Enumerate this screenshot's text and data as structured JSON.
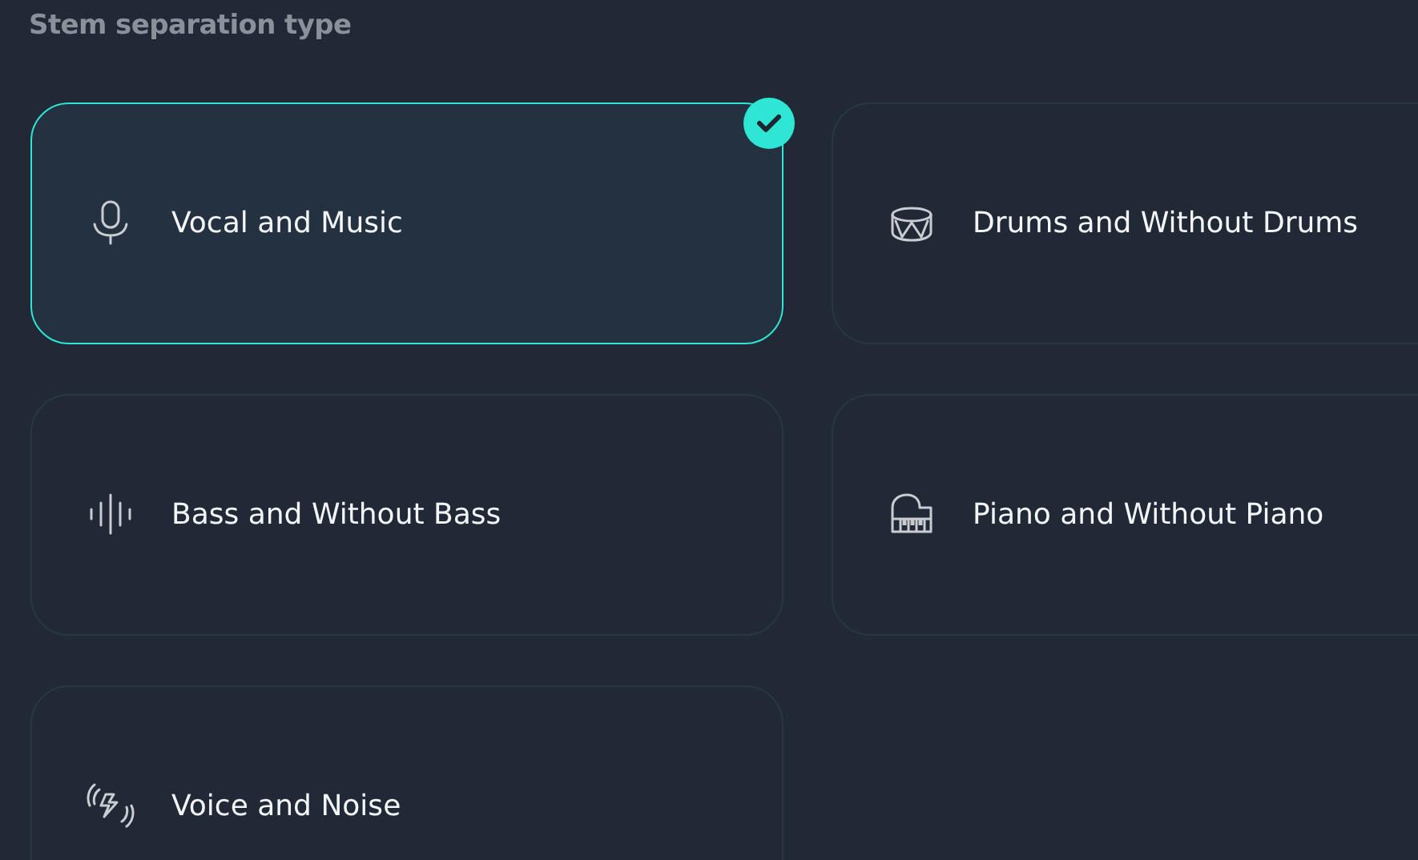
{
  "heading": "Stem separation type",
  "options": [
    {
      "label": "Vocal and Music",
      "kind": "mic",
      "selected": true
    },
    {
      "label": "Drums and Without Drums",
      "kind": "drum",
      "selected": false
    },
    {
      "label": "Bass and Without Bass",
      "kind": "wave",
      "selected": false
    },
    {
      "label": "Piano and Without Piano",
      "kind": "piano",
      "selected": false
    },
    {
      "label": "Voice and Noise",
      "kind": "noise",
      "selected": false
    }
  ]
}
